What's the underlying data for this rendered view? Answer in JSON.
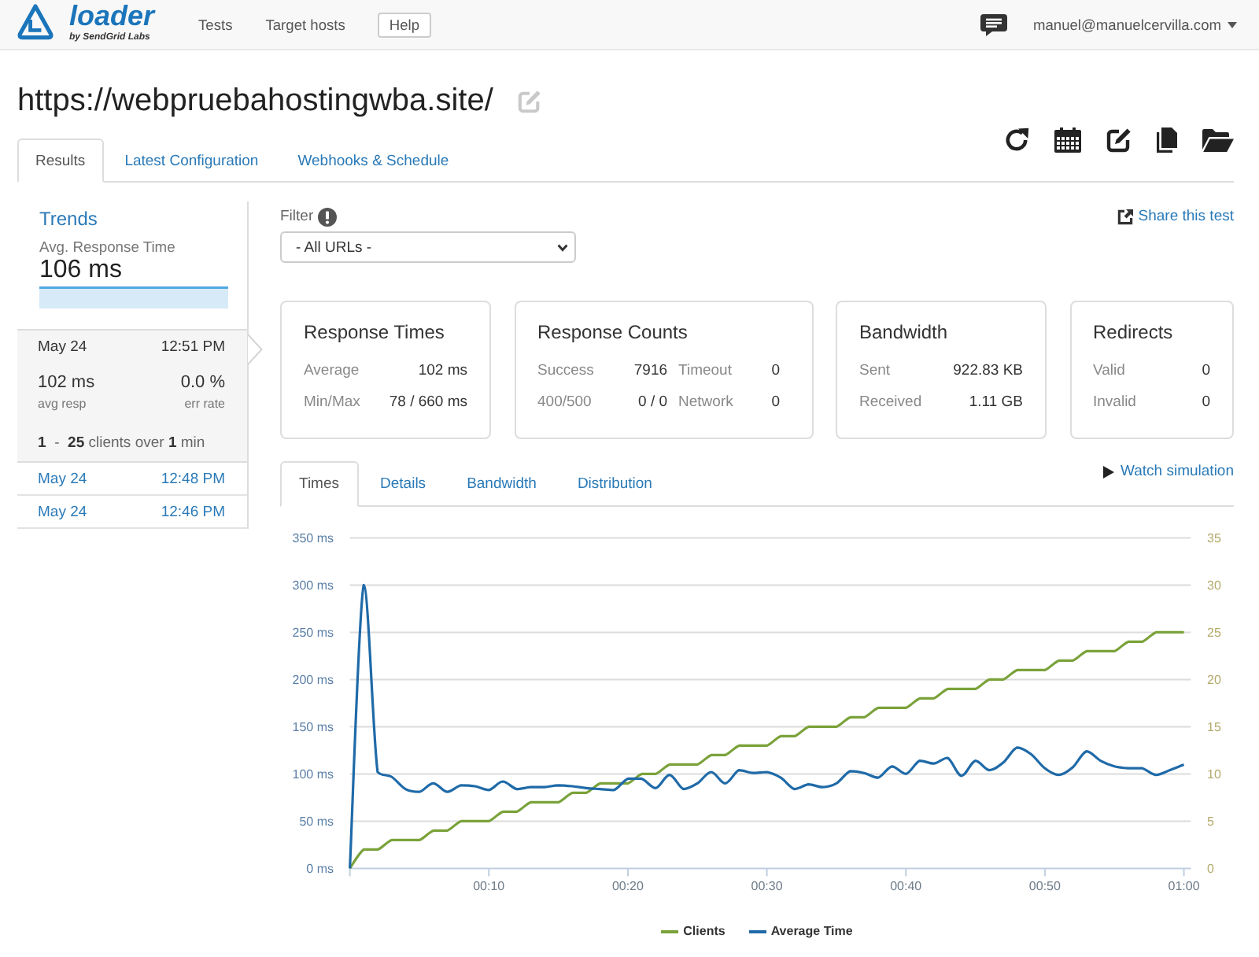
{
  "header": {
    "logo": {
      "wordmark": "loader",
      "tagline": "by SendGrid Labs"
    },
    "nav": [
      {
        "label": "Tests",
        "kind": "link"
      },
      {
        "label": "Target hosts",
        "kind": "link"
      },
      {
        "label": "Help",
        "kind": "button"
      }
    ],
    "user_menu": "manuel@manuelcervilla.com"
  },
  "page_title": "https://webpruebahostingwba.site/",
  "tabs": [
    {
      "label": "Results",
      "selected": true
    },
    {
      "label": "Latest Configuration",
      "selected": false
    },
    {
      "label": "Webhooks & Schedule",
      "selected": false
    }
  ],
  "sidebar": {
    "heading": "Trends",
    "metric_label": "Avg. Response Time",
    "metric_value": "106 ms",
    "runs": [
      {
        "date": "May 24",
        "time": "12:51 PM",
        "selected": true,
        "avg_resp": "102 ms",
        "avg_resp_label": "avg resp",
        "err_rate": "0.0 %",
        "err_rate_label": "err rate",
        "summary": "**1**  -  **25** clients over **1** min"
      },
      {
        "date": "May 24",
        "time": "12:48 PM",
        "selected": false
      },
      {
        "date": "May 24",
        "time": "12:46 PM",
        "selected": false
      }
    ]
  },
  "filter": {
    "label": "Filter",
    "value": "- All URLs -"
  },
  "share_link": "Share this test",
  "cards": [
    {
      "title": "Response Times",
      "rows": [
        {
          "pairs": [
            {
              "label": "Average",
              "value": "102 ms"
            }
          ]
        },
        {
          "pairs": [
            {
              "label": "Min/Max",
              "value": "78 / 660 ms"
            }
          ]
        }
      ]
    },
    {
      "title": "Response Counts",
      "rows": [
        {
          "pairs": [
            {
              "label": "Success",
              "value": "7916"
            },
            {
              "label": "Timeout",
              "value": "0"
            }
          ]
        },
        {
          "pairs": [
            {
              "label": "400/500",
              "value": "0 / 0"
            },
            {
              "label": "Network",
              "value": "0"
            }
          ]
        }
      ]
    },
    {
      "title": "Bandwidth",
      "rows": [
        {
          "pairs": [
            {
              "label": "Sent",
              "value": "922.83 KB"
            }
          ]
        },
        {
          "pairs": [
            {
              "label": "Received",
              "value": "1.11 GB"
            }
          ]
        }
      ]
    },
    {
      "title": "Redirects",
      "rows": [
        {
          "pairs": [
            {
              "label": "Valid",
              "value": "0"
            }
          ]
        },
        {
          "pairs": [
            {
              "label": "Invalid",
              "value": "0"
            }
          ]
        }
      ]
    }
  ],
  "chart_panel": {
    "tabs": [
      {
        "label": "Times",
        "selected": true
      },
      {
        "label": "Details",
        "selected": false
      },
      {
        "label": "Bandwidth",
        "selected": false
      },
      {
        "label": "Distribution",
        "selected": false
      }
    ],
    "watch_link": "Watch simulation",
    "chart_data": {
      "type": "line",
      "grid": true,
      "legend": true,
      "x": [
        0,
        1,
        2,
        3,
        4,
        5,
        6,
        7,
        8,
        9,
        10,
        11,
        12,
        13,
        14,
        15,
        16,
        17,
        18,
        19,
        20,
        21,
        22,
        23,
        24,
        25,
        26,
        27,
        28,
        29,
        30,
        31,
        32,
        33,
        34,
        35,
        36,
        37,
        38,
        39,
        40,
        41,
        42,
        43,
        44,
        45,
        46,
        47,
        48,
        49,
        50,
        51,
        52,
        53,
        54,
        55,
        56,
        57,
        58,
        59,
        60
      ],
      "xlim": [
        0,
        60.5
      ],
      "xticks": [
        {
          "value": 10,
          "label": "00:10"
        },
        {
          "value": 20,
          "label": "00:20"
        },
        {
          "value": 30,
          "label": "00:30"
        },
        {
          "value": 40,
          "label": "00:40"
        },
        {
          "value": 50,
          "label": "00:50"
        },
        {
          "value": 60,
          "label": "01:00"
        }
      ],
      "ylim": [
        0,
        350
      ],
      "yticks": [
        {
          "value": 0,
          "label": "0 ms"
        },
        {
          "value": 50,
          "label": "50 ms"
        },
        {
          "value": 100,
          "label": "100 ms"
        },
        {
          "value": 150,
          "label": "150 ms"
        },
        {
          "value": 200,
          "label": "200 ms"
        },
        {
          "value": 250,
          "label": "250 ms"
        },
        {
          "value": 300,
          "label": "300 ms"
        },
        {
          "value": 350,
          "label": "350 ms"
        }
      ],
      "y2lim": [
        0,
        35
      ],
      "y2ticks": [
        {
          "value": 0,
          "label": "0"
        },
        {
          "value": 5,
          "label": "5"
        },
        {
          "value": 10,
          "label": "10"
        },
        {
          "value": 15,
          "label": "15"
        },
        {
          "value": 20,
          "label": "20"
        },
        {
          "value": 25,
          "label": "25"
        },
        {
          "value": 30,
          "label": "30"
        },
        {
          "value": 35,
          "label": "35"
        }
      ],
      "series": [
        {
          "name": "Clients",
          "color": "#7aa23a",
          "axis": "y2",
          "values": [
            0,
            2,
            2,
            3,
            3,
            3,
            4,
            4,
            5,
            5,
            5,
            6,
            6,
            7,
            7,
            7,
            8,
            8,
            9,
            9,
            9,
            10,
            10,
            11,
            11,
            11,
            12,
            12,
            13,
            13,
            13,
            14,
            14,
            15,
            15,
            15,
            16,
            16,
            17,
            17,
            17,
            18,
            18,
            19,
            19,
            19,
            20,
            20,
            21,
            21,
            21,
            22,
            22,
            23,
            23,
            23,
            24,
            24,
            25,
            25,
            25
          ]
        },
        {
          "name": "Average Time",
          "color": "#1f6aa8",
          "values": [
            0,
            300,
            102,
            97,
            84,
            81,
            90,
            81,
            88,
            87,
            83,
            92,
            84,
            86,
            86,
            88,
            87,
            85,
            84,
            83,
            95,
            95,
            85,
            99,
            84,
            90,
            102,
            90,
            104,
            101,
            102,
            96,
            84,
            89,
            86,
            90,
            103,
            101,
            96,
            108,
            100,
            114,
            111,
            117,
            98,
            114,
            104,
            112,
            128,
            121,
            106,
            99,
            107,
            124,
            114,
            108,
            106,
            106,
            99,
            104,
            110
          ]
        }
      ]
    }
  }
}
